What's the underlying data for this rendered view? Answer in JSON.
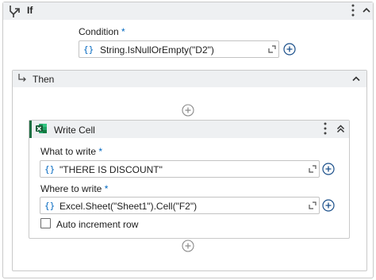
{
  "if_activity": {
    "title": "If",
    "menu_icon": "vertical-ellipsis-icon",
    "collapse_icon": "chevron-up-icon",
    "condition": {
      "label": "Condition",
      "required_mark": "*",
      "value": "String.IsNullOrEmpty(\"D2\")"
    }
  },
  "then_section": {
    "label": "Then",
    "write_cell": {
      "title": "Write Cell",
      "what_to_write": {
        "label": "What to write",
        "required_mark": "*",
        "value": "\"THERE IS DISCOUNT\""
      },
      "where_to_write": {
        "label": "Where to write",
        "required_mark": "*",
        "value": "Excel.Sheet(\"Sheet1\").Cell(\"F2\")"
      },
      "auto_increment": {
        "label": "Auto increment row",
        "checked": false
      }
    }
  },
  "field_braces": "{}",
  "colors": {
    "accent_blue": "#0067c0",
    "excel_green": "#1d6f42",
    "header_bg": "#eef0f2",
    "border": "#c9c9c9"
  }
}
